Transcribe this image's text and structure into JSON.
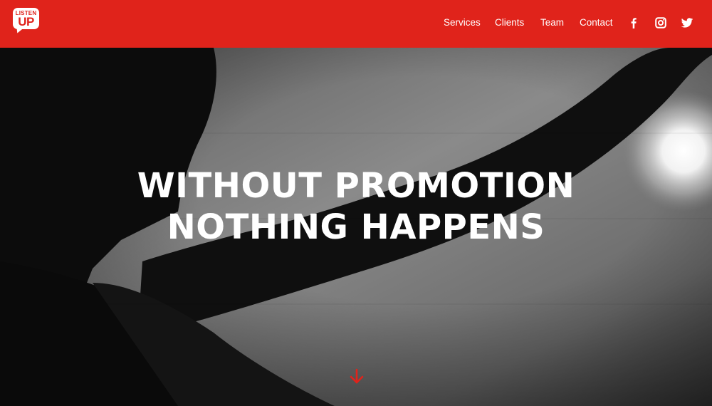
{
  "brand": {
    "logo_top": "LISTEN",
    "logo_bottom": "UP",
    "color": "#e0231b"
  },
  "nav": {
    "items": [
      {
        "label": "Services"
      },
      {
        "label": "Clients"
      },
      {
        "label": "Team"
      },
      {
        "label": "Contact"
      }
    ]
  },
  "social": {
    "icons": [
      "facebook-icon",
      "instagram-icon",
      "twitter-icon"
    ]
  },
  "hero": {
    "headline_line1": "WITHOUT PROMOTION",
    "headline_line2": "NOTHING HAPPENS",
    "scroll_icon": "arrow-down-icon"
  }
}
